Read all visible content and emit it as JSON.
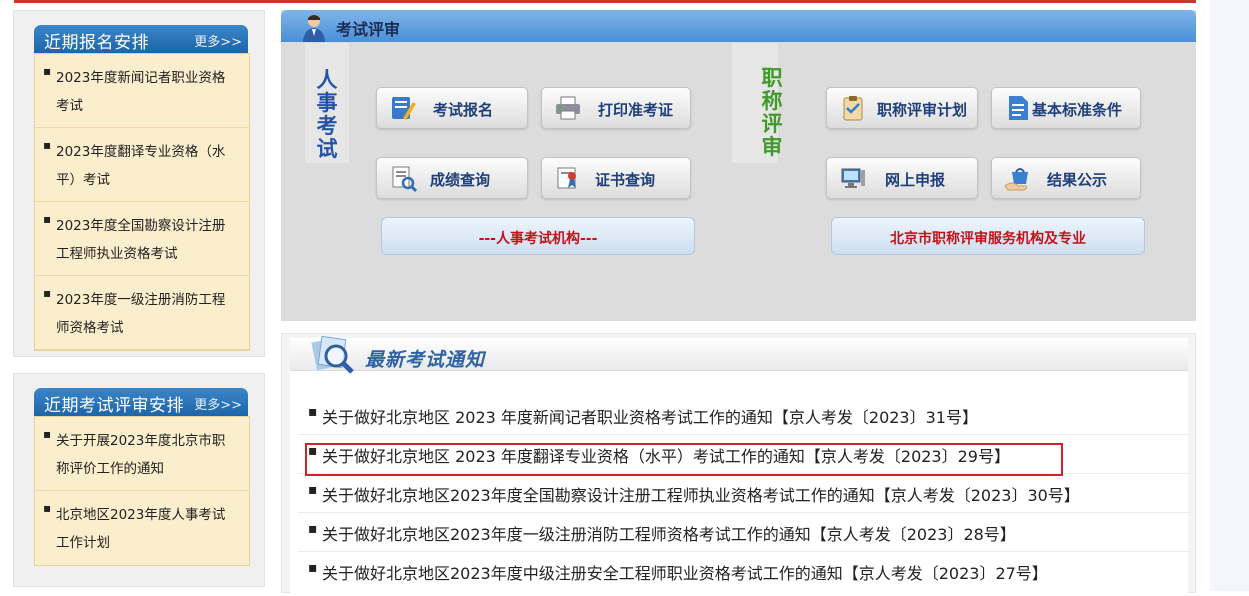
{
  "left_panel_1": {
    "title": "近期报名安排",
    "more": "更多>>",
    "items": [
      {
        "label": "2023年度新闻记者职业资格考试"
      },
      {
        "label": "2023年度翻译专业资格（水平）考试"
      },
      {
        "label": "2023年度全国勘察设计注册工程师执业资格考试"
      },
      {
        "label": "2023年度一级注册消防工程师资格考试"
      }
    ]
  },
  "left_panel_2": {
    "title": "近期考试评审安排",
    "more": "更多>>",
    "items": [
      {
        "label": "关于开展2023年度北京市职称评价工作的通知"
      },
      {
        "label": "北京地区2023年度人事考试工作计划"
      }
    ]
  },
  "exam_section": {
    "title": "考试评审",
    "personnel_label": [
      "人",
      "事",
      "考",
      "试"
    ],
    "title_label": [
      "职",
      "称",
      "评",
      "审"
    ],
    "buttons": [
      {
        "label": "考试报名",
        "icon": "pencil-form-icon"
      },
      {
        "label": "打印准考证",
        "icon": "printer-icon"
      },
      {
        "label": "成绩查询",
        "icon": "document-search-icon"
      },
      {
        "label": "证书查询",
        "icon": "certificate-icon"
      },
      {
        "label": "职称评审计划",
        "icon": "clipboard-icon"
      },
      {
        "label": "基本标准条件",
        "icon": "document-icon"
      },
      {
        "label": "网上申报",
        "icon": "computer-icon"
      },
      {
        "label": "结果公示",
        "icon": "hand-bag-icon"
      }
    ],
    "wide_buttons": [
      {
        "label": "---人事考试机构---"
      },
      {
        "label": "北京市职称评审服务机构及专业"
      }
    ]
  },
  "notice_section": {
    "title": "最新考试通知",
    "items": [
      {
        "label": "关于做好北京地区 2023 年度新闻记者职业资格考试工作的通知【京人考发〔2023〕31号】"
      },
      {
        "label": "关于做好北京地区 2023 年度翻译专业资格（水平）考试工作的通知【京人考发〔2023〕29号】"
      },
      {
        "label": "关于做好北京地区2023年度全国勘察设计注册工程师执业资格考试工作的通知【京人考发〔2023〕30号】"
      },
      {
        "label": "关于做好北京地区2023年度一级注册消防工程师资格考试工作的通知【京人考发〔2023〕28号】"
      },
      {
        "label": "关于做好北京地区2023年度中级注册安全工程师职业资格考试工作的通知【京人考发〔2023〕27号】"
      }
    ]
  },
  "colors": {
    "accent_blue": "#1e64a9",
    "highlight_red": "#d0232a",
    "personnel_label": "#2453a5",
    "title_label": "#3f9a2a"
  }
}
